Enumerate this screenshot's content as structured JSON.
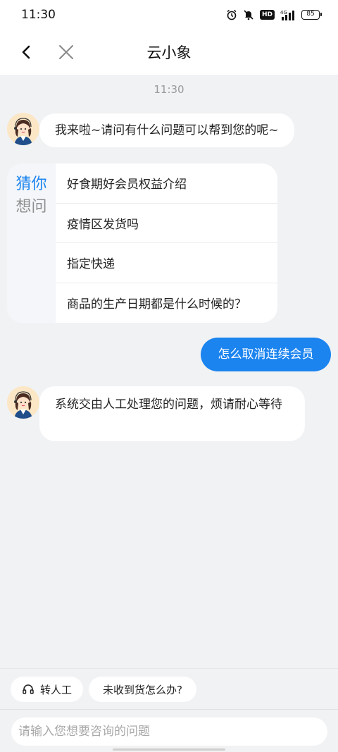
{
  "status_bar": {
    "time": "11:30",
    "icons": [
      "alarm-icon",
      "mute-bell-icon",
      "hd-badge",
      "4g-signal-icon",
      "battery-icon"
    ],
    "hd_label": "HD",
    "network_label": "4G",
    "battery_level": "85"
  },
  "header": {
    "title": "云小象",
    "back_icon": "chevron-left-icon",
    "close_icon": "close-icon"
  },
  "chat": {
    "timestamp": "11:30",
    "greeting": "我来啦~请问有什么问题可以帮到您的呢~",
    "guess": {
      "label_line1": "猜你",
      "label_line2": "想问",
      "items": [
        "好食期好会员权益介绍",
        "疫情区发货吗",
        "指定快递",
        "商品的生产日期都是什么时候的？"
      ]
    },
    "user_message": "怎么取消连续会员",
    "bot_reply": "系统交由人工处理您的问题，烦请耐心等待"
  },
  "quick_actions": {
    "human_agent": "转人工",
    "not_received": "未收到货怎么办?"
  },
  "input": {
    "placeholder": "请输入您想要咨询的问题"
  },
  "colors": {
    "accent": "#1b84ef",
    "background": "#f1f2f4",
    "bubble": "#ffffff"
  }
}
